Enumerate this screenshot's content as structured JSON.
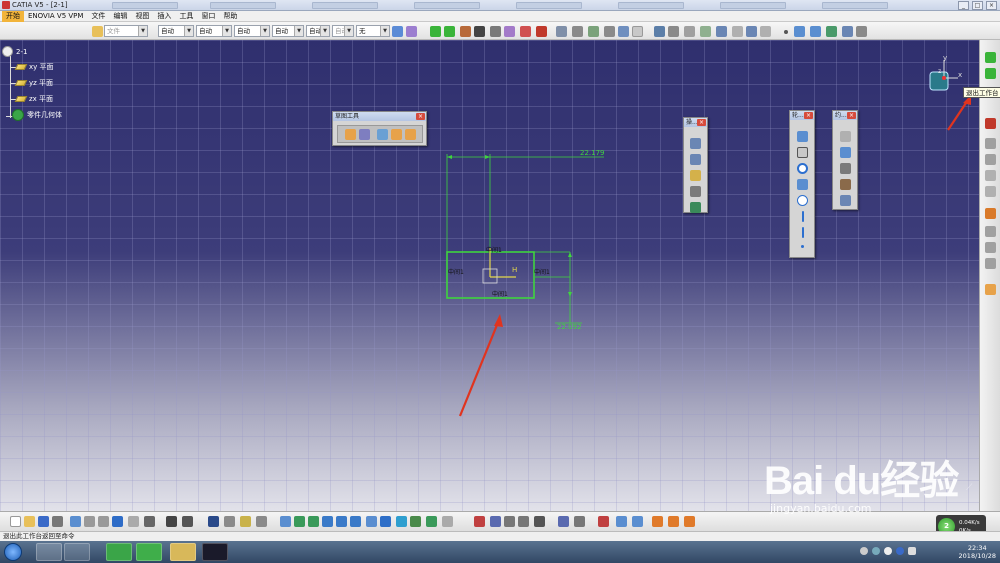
{
  "window": {
    "title": "CATIA V5 - [2-1]",
    "controls": [
      "_",
      "□",
      "×"
    ]
  },
  "menu": {
    "items": [
      "开始",
      "ENOVIA V5 VPM",
      "文件",
      "编辑",
      "视图",
      "插入",
      "工具",
      "窗口",
      "帮助"
    ]
  },
  "toolbar": {
    "combos": [
      "文件",
      "自动",
      "自动",
      "自动",
      "自动",
      "自动",
      "自动",
      "无"
    ]
  },
  "tree": {
    "root": "2-1",
    "planes": [
      "xy 平面",
      "yz 平面",
      "zx 平面"
    ],
    "body": "零件几何体"
  },
  "panels": {
    "sketch_tools": {
      "title": "草图工具"
    },
    "p1": {
      "title": "操..."
    },
    "p2": {
      "title": "轮..."
    },
    "p3": {
      "title": "约..."
    }
  },
  "sketch": {
    "dim_top": "22.179",
    "dim_bottom": "22.092",
    "h_label": "H",
    "v_label": "V",
    "c_labels": [
      "中间1",
      "中间1",
      "中间1",
      "中间1"
    ]
  },
  "compass": {
    "x": "x",
    "y": "y",
    "z": "z"
  },
  "tooltip": "退出工作台",
  "status": {
    "text": "退出此工作台返回至命令",
    "speed_percent": "2",
    "upload": "0.04K/s",
    "download": "0K/s"
  },
  "taskbar": {
    "time": "22:34",
    "date": "2018/10/28"
  },
  "watermark": {
    "brand": "Bai du经验",
    "url": "jingyan.baidu.com"
  },
  "colors": {
    "canvas_top": "#2f2f6e",
    "sketch": "#3fd43f",
    "accent_menu": "#f2b43a",
    "arrow": "#e0341f"
  }
}
